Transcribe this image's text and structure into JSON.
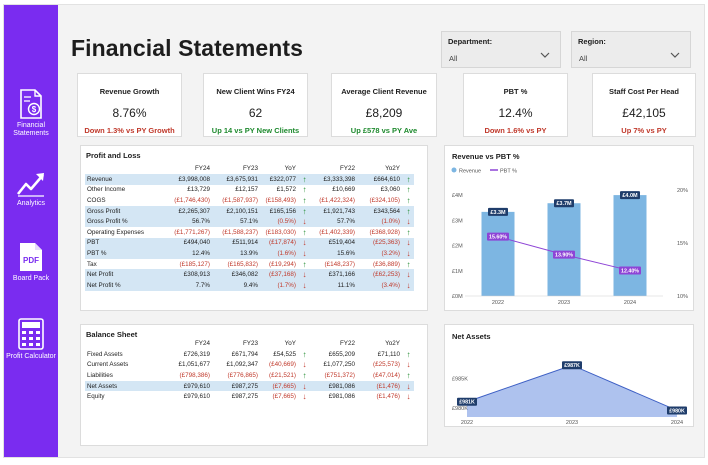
{
  "page_title": "Financial Statements",
  "nav": [
    {
      "label": "Financial Statements",
      "icon": "document-dollar-icon"
    },
    {
      "label": "Analytics",
      "icon": "trend-chart-icon"
    },
    {
      "label": "Board Pack",
      "icon": "pdf-file-icon",
      "icon_text": "PDF"
    },
    {
      "label": "Profit Calculator",
      "icon": "calculator-icon"
    }
  ],
  "filters": {
    "department": {
      "label": "Department:",
      "value": "All"
    },
    "region": {
      "label": "Region:",
      "value": "All"
    }
  },
  "kpis": [
    {
      "title": "Revenue Growth",
      "value": "8.76%",
      "sub": "Down 1.3% vs PY Growth",
      "status": "down"
    },
    {
      "title": "New Client Wins FY24",
      "value": "62",
      "sub": "Up 14 vs PY New Clients",
      "status": "up"
    },
    {
      "title": "Average Client Revenue",
      "value": "£8,209",
      "sub": "Up £578 vs PY Ave",
      "status": "up"
    },
    {
      "title": "PBT %",
      "value": "12.4%",
      "sub": "Down 1.6% vs PY",
      "status": "down"
    },
    {
      "title": "Staff Cost Per Head",
      "value": "£42,105",
      "sub": "Up 7% vs PY",
      "status": "down"
    }
  ],
  "pnl": {
    "title": "Profit and Loss",
    "columns": [
      "",
      "FY24",
      "FY23",
      "YoY",
      "",
      "FY22",
      "Yo2Y",
      ""
    ],
    "rows": [
      {
        "label": "Revenue",
        "fy24": "£3,998,008",
        "fy23": "£3,675,931",
        "yoy": "£322,077",
        "yoy_arrow": "up",
        "fy22": "£3,333,398",
        "yo2y": "£664,610",
        "yo2y_arrow": "up",
        "hl": true
      },
      {
        "label": "Other Income",
        "fy24": "£13,729",
        "fy23": "£12,157",
        "yoy": "£1,572",
        "yoy_arrow": "up",
        "fy22": "£10,669",
        "yo2y": "£3,060",
        "yo2y_arrow": "up",
        "hl": false
      },
      {
        "label": "COGS",
        "fy24": "(£1,746,430)",
        "fy23": "(£1,587,937)",
        "yoy": "(£158,493)",
        "yoy_arrow": "up",
        "fy22": "(£1,422,324)",
        "yo2y": "(£324,105)",
        "yo2y_arrow": "up",
        "hl": false
      },
      {
        "label": "Gross Profit",
        "fy24": "£2,265,307",
        "fy23": "£2,100,151",
        "yoy": "£165,156",
        "yoy_arrow": "up",
        "fy22": "£1,921,743",
        "yo2y": "£343,564",
        "yo2y_arrow": "up",
        "hl": true
      },
      {
        "label": "Gross Profit %",
        "fy24": "56.7%",
        "fy23": "57.1%",
        "yoy": "(0.5%)",
        "yoy_arrow": "down",
        "fy22": "57.7%",
        "yo2y": "(1.0%)",
        "yo2y_arrow": "down",
        "hl": true
      },
      {
        "label": "Operating Expenses",
        "fy24": "(£1,771,267)",
        "fy23": "(£1,588,237)",
        "yoy": "(£183,030)",
        "yoy_arrow": "up",
        "fy22": "(£1,402,339)",
        "yo2y": "(£368,928)",
        "yo2y_arrow": "up",
        "hl": false
      },
      {
        "label": "PBT",
        "fy24": "£494,040",
        "fy23": "£511,914",
        "yoy": "(£17,874)",
        "yoy_arrow": "down",
        "fy22": "£519,404",
        "yo2y": "(£25,363)",
        "yo2y_arrow": "down",
        "hl": true
      },
      {
        "label": "PBT %",
        "fy24": "12.4%",
        "fy23": "13.9%",
        "yoy": "(1.6%)",
        "yoy_arrow": "down",
        "fy22": "15.6%",
        "yo2y": "(3.2%)",
        "yo2y_arrow": "down",
        "hl": true
      },
      {
        "label": "Tax",
        "fy24": "(£185,127)",
        "fy23": "(£165,832)",
        "yoy": "(£19,294)",
        "yoy_arrow": "up",
        "fy22": "(£148,237)",
        "yo2y": "(£36,889)",
        "yo2y_arrow": "up",
        "hl": false
      },
      {
        "label": "Net Profit",
        "fy24": "£308,913",
        "fy23": "£346,082",
        "yoy": "(£37,168)",
        "yoy_arrow": "down",
        "fy22": "£371,166",
        "yo2y": "(£62,253)",
        "yo2y_arrow": "down",
        "hl": true
      },
      {
        "label": "Net Profit %",
        "fy24": "7.7%",
        "fy23": "9.4%",
        "yoy": "(1.7%)",
        "yoy_arrow": "down",
        "fy22": "11.1%",
        "yo2y": "(3.4%)",
        "yo2y_arrow": "down",
        "hl": true
      }
    ]
  },
  "balance_sheet": {
    "title": "Balance Sheet",
    "columns": [
      "",
      "FY24",
      "FY23",
      "YoY",
      "",
      "FY22",
      "Yo2Y",
      ""
    ],
    "rows": [
      {
        "label": "Fixed Assets",
        "fy24": "£726,319",
        "fy23": "£671,794",
        "yoy": "£54,525",
        "yoy_arrow": "up",
        "fy22": "£655,209",
        "yo2y": "£71,110",
        "yo2y_arrow": "up",
        "hl": false
      },
      {
        "label": "Current Assets",
        "fy24": "£1,051,677",
        "fy23": "£1,092,347",
        "yoy": "(£40,669)",
        "yoy_arrow": "down",
        "fy22": "£1,077,250",
        "yo2y": "(£25,573)",
        "yo2y_arrow": "down",
        "hl": false
      },
      {
        "label": "Liabilities",
        "fy24": "(£798,386)",
        "fy23": "(£776,865)",
        "yoy": "(£21,521)",
        "yoy_arrow": "up",
        "fy22": "(£751,372)",
        "yo2y": "(£47,014)",
        "yo2y_arrow": "up",
        "hl": false
      },
      {
        "label": "Net Assets",
        "fy24": "£979,610",
        "fy23": "£987,275",
        "yoy": "(£7,665)",
        "yoy_arrow": "down",
        "fy22": "£981,086",
        "yo2y": "(£1,476)",
        "yo2y_arrow": "down",
        "hl": true
      },
      {
        "label": "Equity",
        "fy24": "£979,610",
        "fy23": "£987,275",
        "yoy": "(£7,665)",
        "yoy_arrow": "down",
        "fy22": "£981,086",
        "yo2y": "(£1,476)",
        "yo2y_arrow": "down",
        "hl": false
      }
    ]
  },
  "chart_data": [
    {
      "type": "bar",
      "title": "Revenue vs PBT %",
      "legend": [
        "Revenue",
        "PBT %"
      ],
      "legend_position": "top-left",
      "categories": [
        "2022",
        "2023",
        "2024"
      ],
      "series": [
        {
          "name": "Revenue",
          "type": "bar",
          "values": [
            3333398,
            3675931,
            3998008
          ],
          "labels": [
            "£3.3M",
            "£3.7M",
            "£4.0M"
          ],
          "color": "#7db6e2"
        },
        {
          "name": "PBT %",
          "type": "line",
          "axis": "right",
          "values": [
            15.6,
            13.9,
            12.4
          ],
          "labels": [
            "15.60%",
            "13.90%",
            "12.40%"
          ],
          "color": "#8e44d6"
        }
      ],
      "yticks": [
        "£0M",
        "£1M",
        "£2M",
        "£3M",
        "£4M"
      ],
      "ylim": [
        0,
        4200000
      ],
      "y2ticks": [
        "10%",
        "15%",
        "20%"
      ],
      "y2lim": [
        10,
        20
      ]
    },
    {
      "type": "area",
      "title": "Net Assets",
      "categories": [
        "2022",
        "2023",
        "2024"
      ],
      "values": [
        981086,
        987275,
        979610
      ],
      "labels": [
        "£981K",
        "£987K",
        "£980K"
      ],
      "yticks": [
        "£980K",
        "£985K"
      ],
      "ylim": [
        978500,
        988500
      ],
      "color": "#6b8fe0"
    }
  ],
  "colors": {
    "sidebar": "#7a2cf0",
    "highlight_row": "#d4e6f4",
    "negative": "#c0392b",
    "positive": "#1e8a2e",
    "bar": "#7db6e2",
    "line": "#8e44d6",
    "area": "#6b8fe0",
    "label_bg": "#1f3d6b"
  }
}
